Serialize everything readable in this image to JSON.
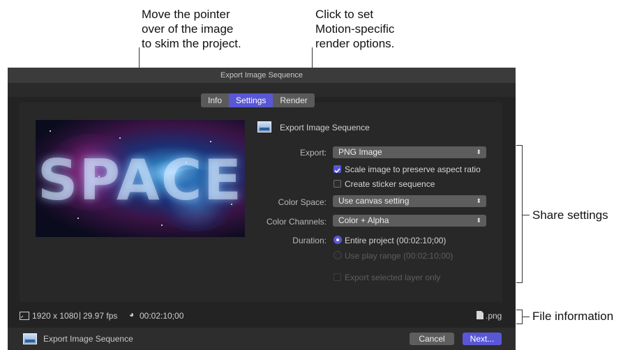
{
  "callouts": {
    "skim": "Move the pointer\nover of the image\nto skim the project.",
    "render": "Click to set\nMotion-specific\nrender options.",
    "share": "Share settings",
    "file_info": "File information"
  },
  "window": {
    "title": "Export Image Sequence"
  },
  "tabs": [
    {
      "label": "Info",
      "active": false
    },
    {
      "label": "Settings",
      "active": true
    },
    {
      "label": "Render",
      "active": false
    }
  ],
  "preview": {
    "text": "SPACE"
  },
  "header": {
    "title": "Export Image Sequence"
  },
  "settings": {
    "export_label": "Export:",
    "export_value": "PNG Image",
    "scale_label": "Scale image to preserve aspect ratio",
    "scale_checked": true,
    "sticker_label": "Create sticker sequence",
    "sticker_checked": false,
    "color_space_label": "Color Space:",
    "color_space_value": "Use canvas setting",
    "color_channels_label": "Color Channels:",
    "color_channels_value": "Color + Alpha",
    "duration_label": "Duration:",
    "entire_project": "Entire project (00:02:10;00)",
    "play_range": "Use play range (00:02:10;00)",
    "export_selected_layer": "Export selected layer only"
  },
  "file_info": {
    "resolution": "1920 x 1080",
    "fps": "29.97 fps",
    "duration": "00:02:10;00",
    "extension": ".png"
  },
  "bottombar": {
    "label": "Export Image Sequence",
    "cancel": "Cancel",
    "next": "Next..."
  },
  "colors": {
    "accent": "#5a57d6",
    "window_bg": "#232323"
  }
}
